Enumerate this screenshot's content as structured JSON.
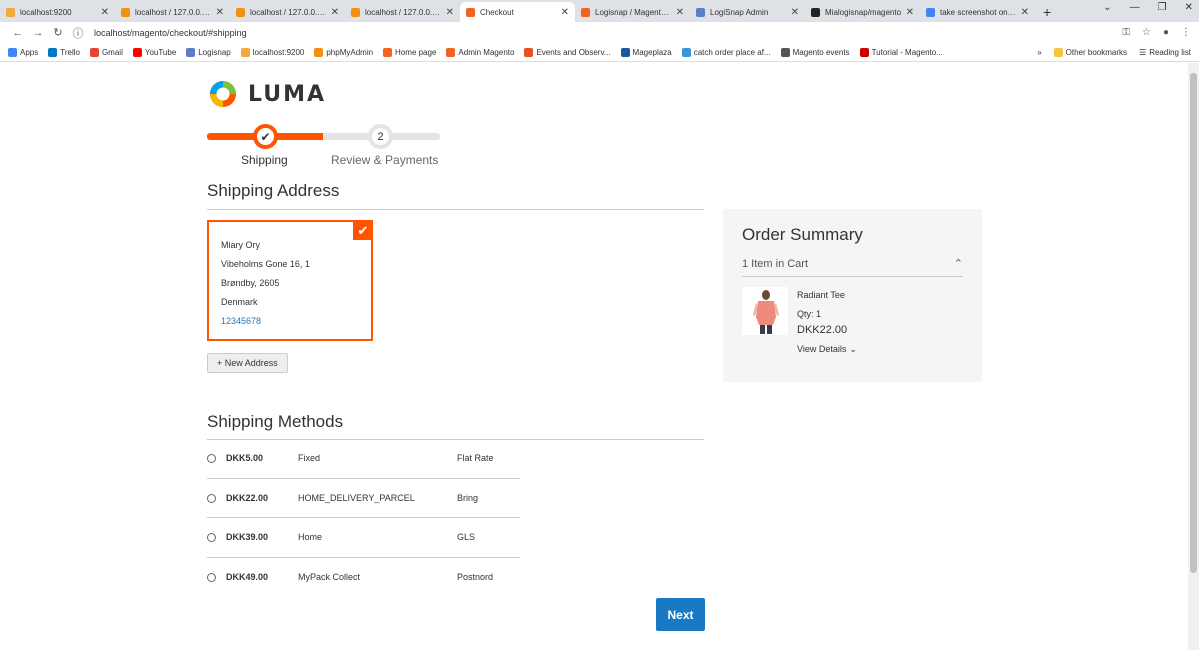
{
  "browser": {
    "tabs": [
      {
        "title": "localhost:9200",
        "color": "#f2a83a",
        "active": false
      },
      {
        "title": "localhost / 127.0.0.1 / ...",
        "color": "#f29111",
        "active": false
      },
      {
        "title": "localhost / 127.0.0.1 / ...",
        "color": "#f29111",
        "active": false
      },
      {
        "title": "localhost / 127.0.0.1 / ...",
        "color": "#f29111",
        "active": false
      },
      {
        "title": "Checkout",
        "color": "#f26322",
        "active": true
      },
      {
        "title": "Logisnap / Magento A...",
        "color": "#f26322",
        "active": false
      },
      {
        "title": "LogiSnap Admin",
        "color": "#5a7fc4",
        "active": false
      },
      {
        "title": "Mialogisnap/magento",
        "color": "#222222",
        "active": false
      },
      {
        "title": "take screenshot on w...",
        "color": "#4285f4",
        "active": false
      }
    ],
    "new_tab": "+",
    "url": "localhost/magento/checkout/#shipping",
    "bookmarks": [
      {
        "label": "Apps",
        "color": "#4285f4"
      },
      {
        "label": "Trello",
        "color": "#0079bf"
      },
      {
        "label": "Gmail",
        "color": "#ea4335"
      },
      {
        "label": "YouTube",
        "color": "#ff0000"
      },
      {
        "label": "Logisnap",
        "color": "#5a7fc4"
      },
      {
        "label": "localhost:9200",
        "color": "#f2a83a"
      },
      {
        "label": "phpMyAdmin",
        "color": "#f29111"
      },
      {
        "label": "Home page",
        "color": "#f26322"
      },
      {
        "label": "Admin Magento",
        "color": "#f26322"
      },
      {
        "label": "Events and Observ...",
        "color": "#e84f1c"
      },
      {
        "label": "Mageplaza",
        "color": "#1a5a9c"
      },
      {
        "label": "catch order place af...",
        "color": "#3498db"
      },
      {
        "label": "Magento events",
        "color": "#555555"
      },
      {
        "label": "Tutorial - Magento...",
        "color": "#cc0000"
      }
    ],
    "bookmarks_more": "»",
    "other_bookmarks": "Other bookmarks",
    "reading_list": "Reading list"
  },
  "brand": {
    "name": "LUMA"
  },
  "progress": {
    "steps": [
      {
        "number": "✔",
        "label": "Shipping"
      },
      {
        "number": "2",
        "label": "Review & Payments"
      }
    ]
  },
  "shipping_address": {
    "title": "Shipping Address",
    "card": {
      "name": "Miary Ory",
      "street": "Vibeholms Gone 16, 1",
      "city": "Brøndby, 2605",
      "country": "Denmark",
      "phone": "12345678"
    },
    "new_address_label": "+ New Address"
  },
  "shipping_methods": {
    "title": "Shipping Methods",
    "rows": [
      {
        "price": "DKK5.00",
        "method": "Fixed",
        "carrier": "Flat Rate"
      },
      {
        "price": "DKK22.00",
        "method": "HOME_DELIVERY_PARCEL",
        "carrier": "Bring"
      },
      {
        "price": "DKK39.00",
        "method": "Home",
        "carrier": "GLS"
      },
      {
        "price": "DKK49.00",
        "method": "MyPack Collect",
        "carrier": "Postnord"
      }
    ]
  },
  "next_label": "Next",
  "order_summary": {
    "title": "Order Summary",
    "items_count": "1 Item in Cart",
    "item": {
      "name": "Radiant Tee",
      "qty": "Qty: 1",
      "price": "DKK22.00",
      "view_details": "View Details"
    }
  }
}
